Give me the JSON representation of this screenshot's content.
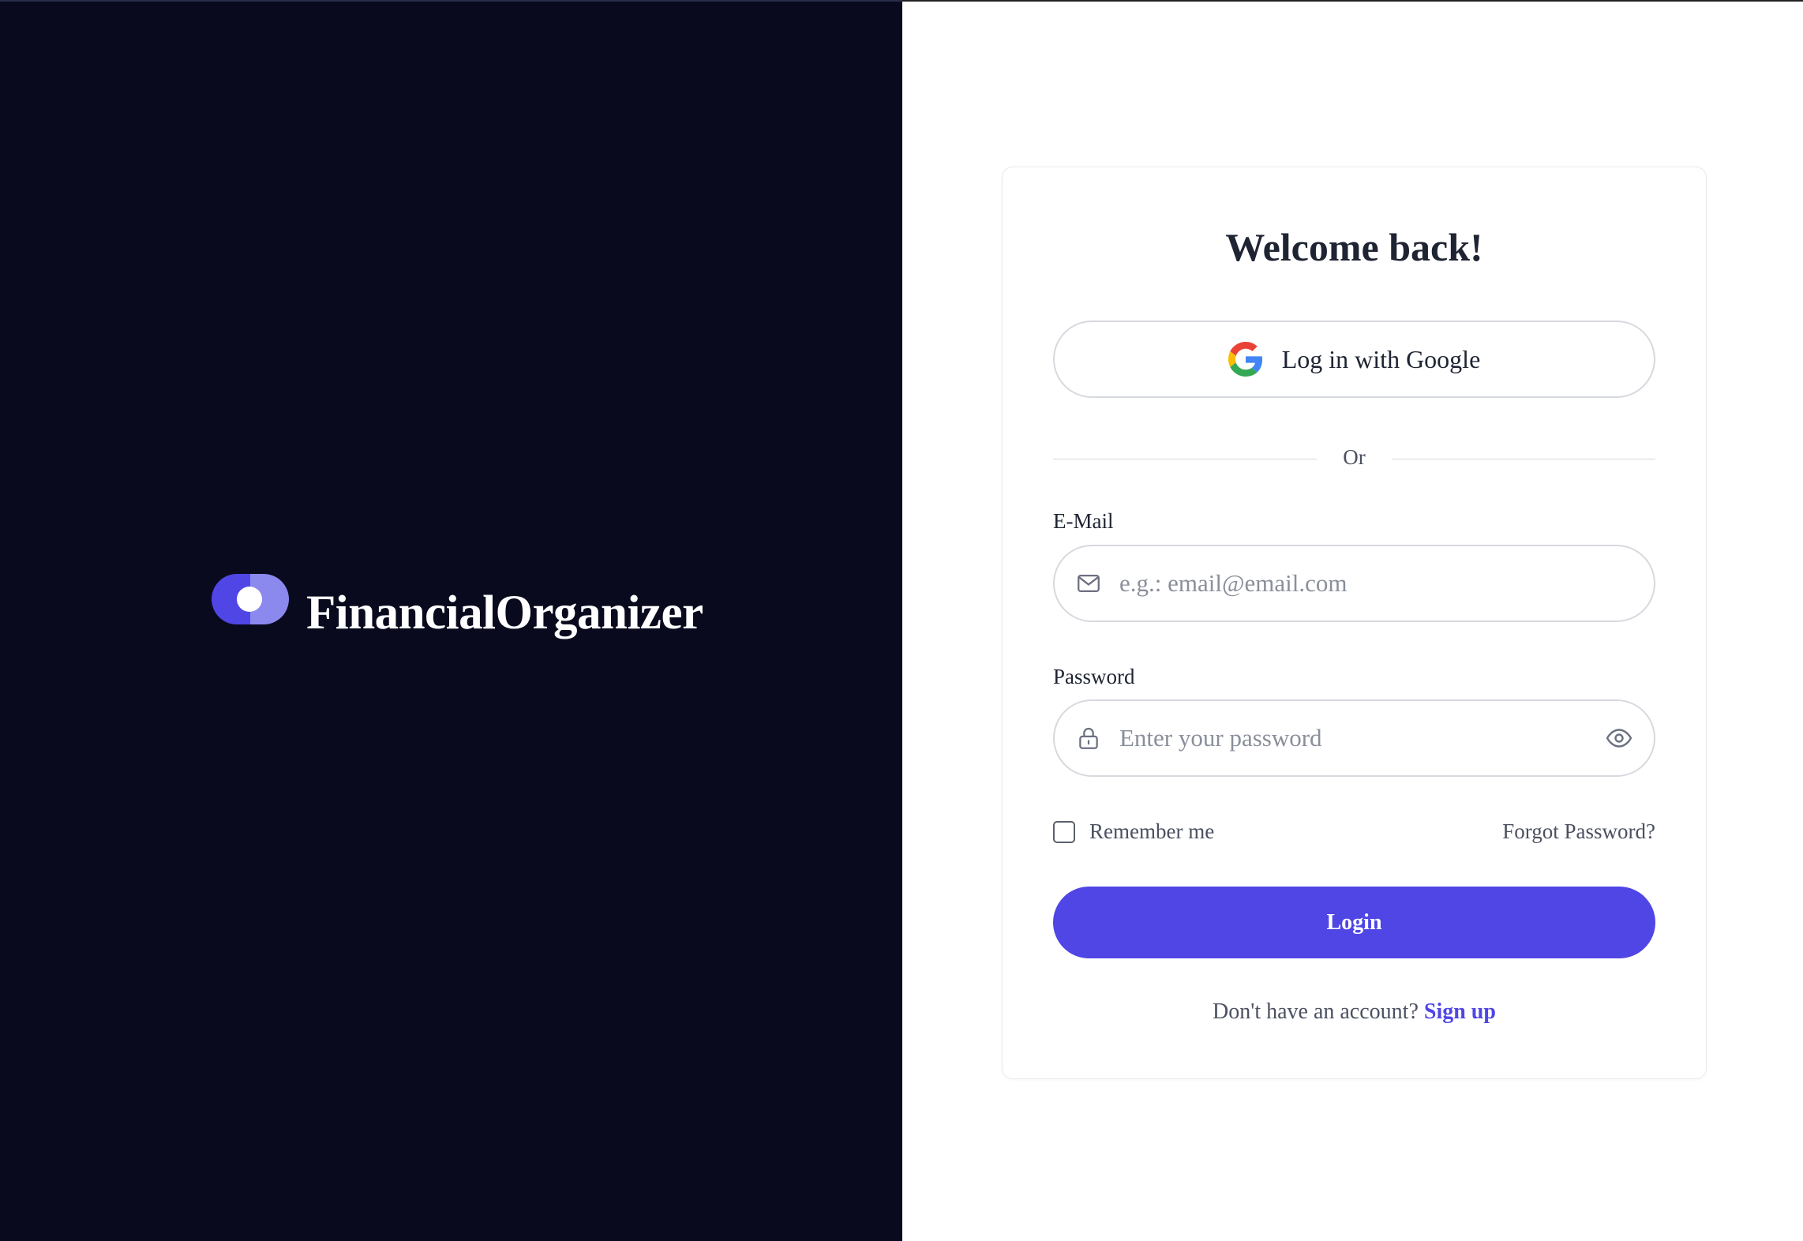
{
  "brand": {
    "name": "FinancialOrganizer",
    "logo_icon": "toggle-logo-icon",
    "colors": {
      "logo_dark": "#4f46e5",
      "logo_light": "#8b88ee",
      "panel_bg": "#090a1e"
    }
  },
  "login": {
    "title": "Welcome back!",
    "google_button_label": "Log in with Google",
    "google_icon": "google-icon",
    "divider_text": "Or",
    "email": {
      "label": "E-Mail",
      "placeholder": "e.g.: email@email.com",
      "value": "",
      "icon": "mail-icon"
    },
    "password": {
      "label": "Password",
      "placeholder": "Enter your password",
      "value": "",
      "icon": "lock-icon",
      "toggle_icon": "eye-icon"
    },
    "remember_me": {
      "label": "Remember me",
      "checked": false
    },
    "forgot_password_label": "Forgot Password?",
    "submit_label": "Login",
    "signup_prompt": "Don't have an account?",
    "signup_link_label": "Sign up",
    "accent_color": "#4f46e5"
  }
}
